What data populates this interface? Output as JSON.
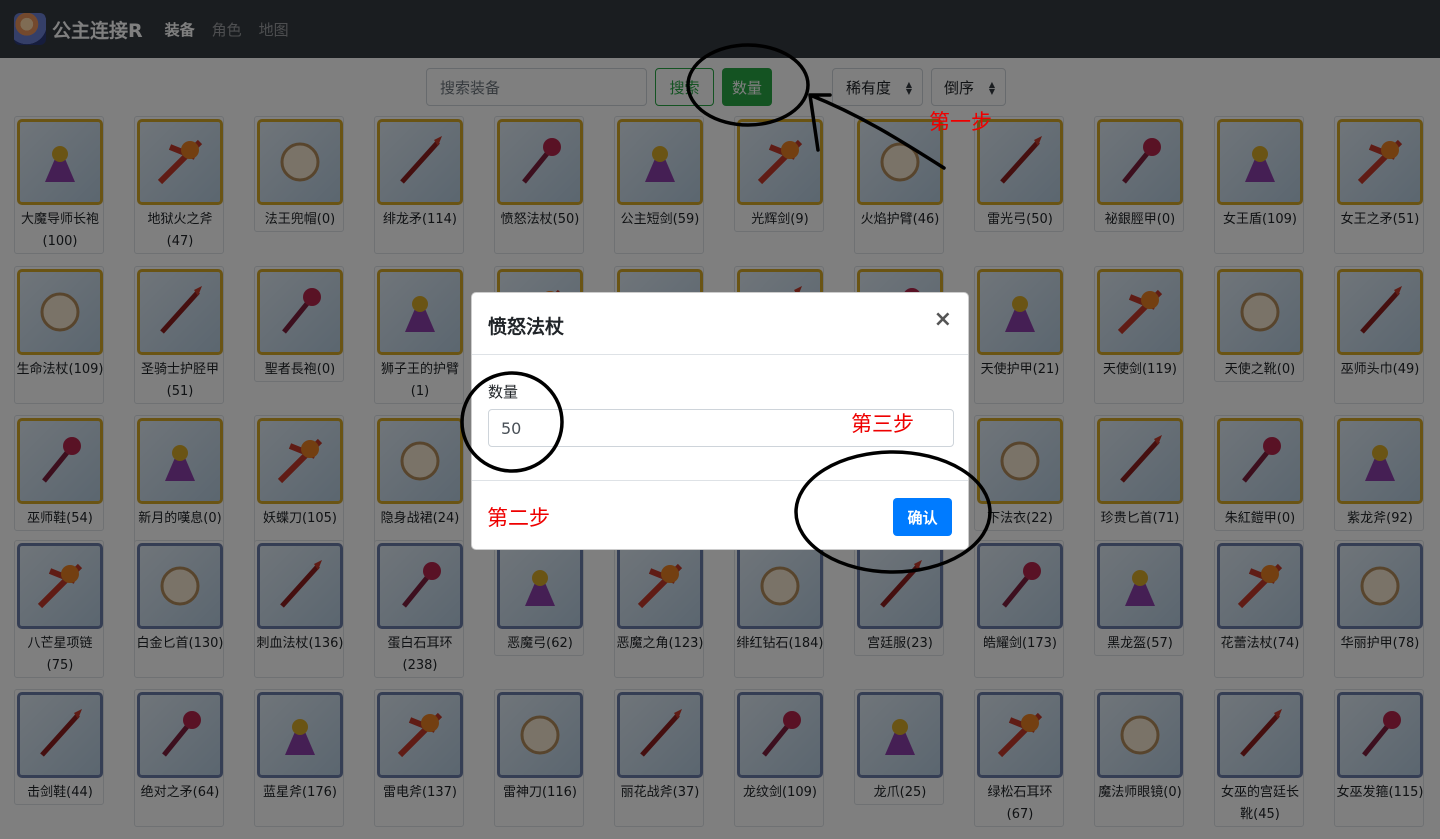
{
  "navbar": {
    "brand": "公主连接R",
    "links": [
      "装备",
      "角色",
      "地图"
    ]
  },
  "toolbar": {
    "search_placeholder": "搜索装备",
    "search_button": "搜索",
    "count_button": "数量",
    "rarity_select": "稀有度",
    "order_select": "倒序"
  },
  "items": [
    {
      "label": "大魔导师长袍(100)",
      "frame": "gold"
    },
    {
      "label": "地狱火之斧(47)",
      "frame": "gold"
    },
    {
      "label": "法王兜帽(0)",
      "frame": "gold"
    },
    {
      "label": "绯龙矛(114)",
      "frame": "gold"
    },
    {
      "label": "愤怒法杖(50)",
      "frame": "gold"
    },
    {
      "label": "公主短剑(59)",
      "frame": "gold"
    },
    {
      "label": "光辉剑(9)",
      "frame": "gold"
    },
    {
      "label": "火焰护臂(46)",
      "frame": "gold"
    },
    {
      "label": "雷光弓(50)",
      "frame": "gold"
    },
    {
      "label": "祕銀脛甲(0)",
      "frame": "gold"
    },
    {
      "label": "女王盾(109)",
      "frame": "gold"
    },
    {
      "label": "女王之矛(51)",
      "frame": "gold"
    },
    {
      "label": "生命法杖(109)",
      "frame": "gold"
    },
    {
      "label": "圣骑士护胫甲(51)",
      "frame": "gold"
    },
    {
      "label": "聖者長袍(0)",
      "frame": "gold"
    },
    {
      "label": "狮子王的护臂(1)",
      "frame": "gold"
    },
    {
      "label": "",
      "frame": "gold"
    },
    {
      "label": "",
      "frame": "gold"
    },
    {
      "label": "",
      "frame": "gold"
    },
    {
      "label": "",
      "frame": "gold"
    },
    {
      "label": "天使护甲(21)",
      "frame": "gold"
    },
    {
      "label": "天使剑(119)",
      "frame": "gold"
    },
    {
      "label": "天使之靴(0)",
      "frame": "gold"
    },
    {
      "label": "巫师头巾(49)",
      "frame": "gold"
    },
    {
      "label": "巫师鞋(54)",
      "frame": "gold"
    },
    {
      "label": "新月的嘆息(0)",
      "frame": "gold"
    },
    {
      "label": "妖蝶刀(105)",
      "frame": "gold"
    },
    {
      "label": "隐身战裙(24)",
      "frame": "gold"
    },
    {
      "label": "",
      "frame": "gold"
    },
    {
      "label": "",
      "frame": "gold"
    },
    {
      "label": "",
      "frame": "gold"
    },
    {
      "label": "",
      "frame": "gold"
    },
    {
      "label": "下法衣(22)",
      "frame": "gold"
    },
    {
      "label": "珍贵匕首(71)",
      "frame": "gold"
    },
    {
      "label": "朱紅鎧甲(0)",
      "frame": "gold"
    },
    {
      "label": "紫龙斧(92)",
      "frame": "gold"
    },
    {
      "label": "八芒星项链(75)",
      "frame": "blue"
    },
    {
      "label": "白金匕首(130)",
      "frame": "blue"
    },
    {
      "label": "刺血法杖(136)",
      "frame": "blue"
    },
    {
      "label": "蛋白石耳环(238)",
      "frame": "blue"
    },
    {
      "label": "恶魔弓(62)",
      "frame": "blue"
    },
    {
      "label": "恶魔之角(123)",
      "frame": "blue"
    },
    {
      "label": "绯红钻石(184)",
      "frame": "blue"
    },
    {
      "label": "宫廷服(23)",
      "frame": "blue"
    },
    {
      "label": "皓耀剑(173)",
      "frame": "blue"
    },
    {
      "label": "黑龙盔(57)",
      "frame": "blue"
    },
    {
      "label": "花蕾法杖(74)",
      "frame": "blue"
    },
    {
      "label": "华丽护甲(78)",
      "frame": "blue"
    },
    {
      "label": "击剑鞋(44)",
      "frame": "blue"
    },
    {
      "label": "绝对之矛(64)",
      "frame": "blue"
    },
    {
      "label": "蓝星斧(176)",
      "frame": "blue"
    },
    {
      "label": "雷电斧(137)",
      "frame": "blue"
    },
    {
      "label": "雷神刀(116)",
      "frame": "blue"
    },
    {
      "label": "丽花战斧(37)",
      "frame": "blue"
    },
    {
      "label": "龙纹剑(109)",
      "frame": "blue"
    },
    {
      "label": "龙爪(25)",
      "frame": "blue"
    },
    {
      "label": "绿松石耳环(67)",
      "frame": "blue"
    },
    {
      "label": "魔法师眼镜(0)",
      "frame": "blue"
    },
    {
      "label": "女巫的宫廷长靴(45)",
      "frame": "blue"
    },
    {
      "label": "女巫发箍(115)",
      "frame": "blue"
    }
  ],
  "modal": {
    "title": "愤怒法杖",
    "close": "×",
    "field_label": "数量",
    "field_value": "50",
    "confirm": "确认"
  },
  "annotations": {
    "step1": "第一步",
    "step2": "第二步",
    "step3": "第三步"
  }
}
